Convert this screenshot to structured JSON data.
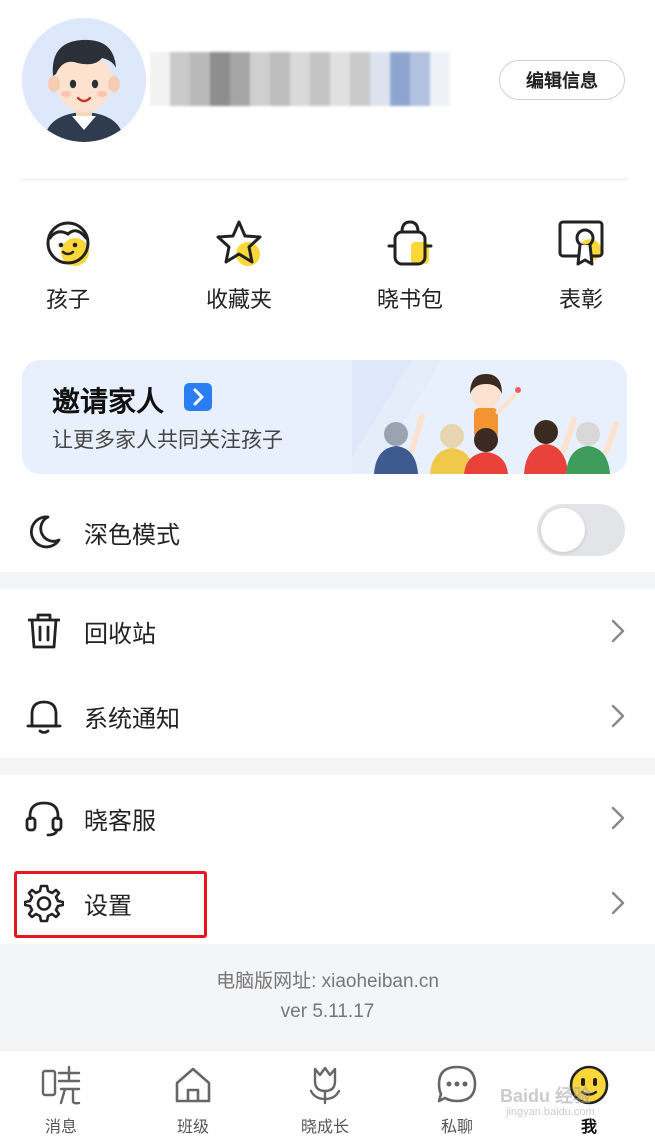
{
  "profile": {
    "edit_label": "编辑信息",
    "name_blur_colors": [
      "#f2f2f2",
      "#c9c9c9",
      "#b9b9b9",
      "#8d8d8d",
      "#a5a5a5",
      "#cfcfcf",
      "#bdbdbd",
      "#d8d8d8",
      "#c4c4c4",
      "#e0e0e0",
      "#cacaca",
      "#dde3ee",
      "#8ea6cf",
      "#b1c1de",
      "#eef2f8"
    ]
  },
  "quick_actions": [
    {
      "label": "孩子",
      "icon": "child-face-icon"
    },
    {
      "label": "收藏夹",
      "icon": "star-icon"
    },
    {
      "label": "晓书包",
      "icon": "schoolbag-icon"
    },
    {
      "label": "表彰",
      "icon": "certificate-icon"
    }
  ],
  "invite": {
    "title": "邀请家人",
    "subtitle": "让更多家人共同关注孩子"
  },
  "dark_mode": {
    "label": "深色模式",
    "enabled": false
  },
  "menu": {
    "recycle": "回收站",
    "notify": "系统通知",
    "service": "晓客服",
    "settings": "设置"
  },
  "footer": {
    "web_url": "电脑版网址: xiaoheiban.cn",
    "version": "ver 5.11.17"
  },
  "tabs": [
    {
      "label": "消息",
      "icon": "xiao-icon"
    },
    {
      "label": "班级",
      "icon": "home-icon"
    },
    {
      "label": "晓成长",
      "icon": "tulip-icon"
    },
    {
      "label": "私聊",
      "icon": "chat-bubble-icon"
    },
    {
      "label": "我",
      "icon": "smiley-avatar-icon"
    }
  ],
  "watermark": {
    "line1": "Baidu 经验",
    "line2": "jingyan.baidu.com"
  },
  "colors": {
    "accent": "#2a7df2",
    "highlight": "#e6151e",
    "yellow": "#fbd73a"
  }
}
